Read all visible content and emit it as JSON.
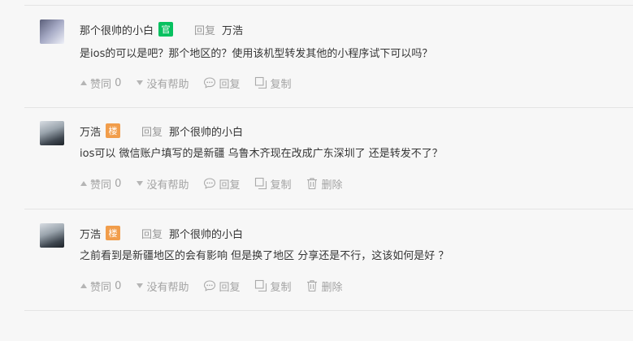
{
  "actions": {
    "like": "赞同",
    "unhelpful": "没有帮助",
    "reply": "回复",
    "copy": "复制",
    "delete": "删除"
  },
  "comments": [
    {
      "author": "那个很帅的小白",
      "badge": "官",
      "badge_color": "#07c160",
      "reply_word": "回复",
      "reply_to": "万浩",
      "text": "是ios的可以是吧？那个地区的？使用该机型转发其他的小程序试下可以吗？",
      "likes": "0"
    },
    {
      "author": "万浩",
      "badge": "楼",
      "badge_color": "#f19d4b",
      "reply_word": "回复",
      "reply_to": "那个很帅的小白",
      "text": "ios可以  微信账户填写的是新疆 乌鲁木齐现在改成广东深圳了  还是转发不了？",
      "likes": "0"
    },
    {
      "author": "万浩",
      "badge": "楼",
      "badge_color": "#f19d4b",
      "reply_word": "回复",
      "reply_to": "那个很帅的小白",
      "text": "之前看到是新疆地区的会有影响  但是换了地区 分享还是不行，这该如何是好 ？",
      "likes": "0"
    }
  ]
}
